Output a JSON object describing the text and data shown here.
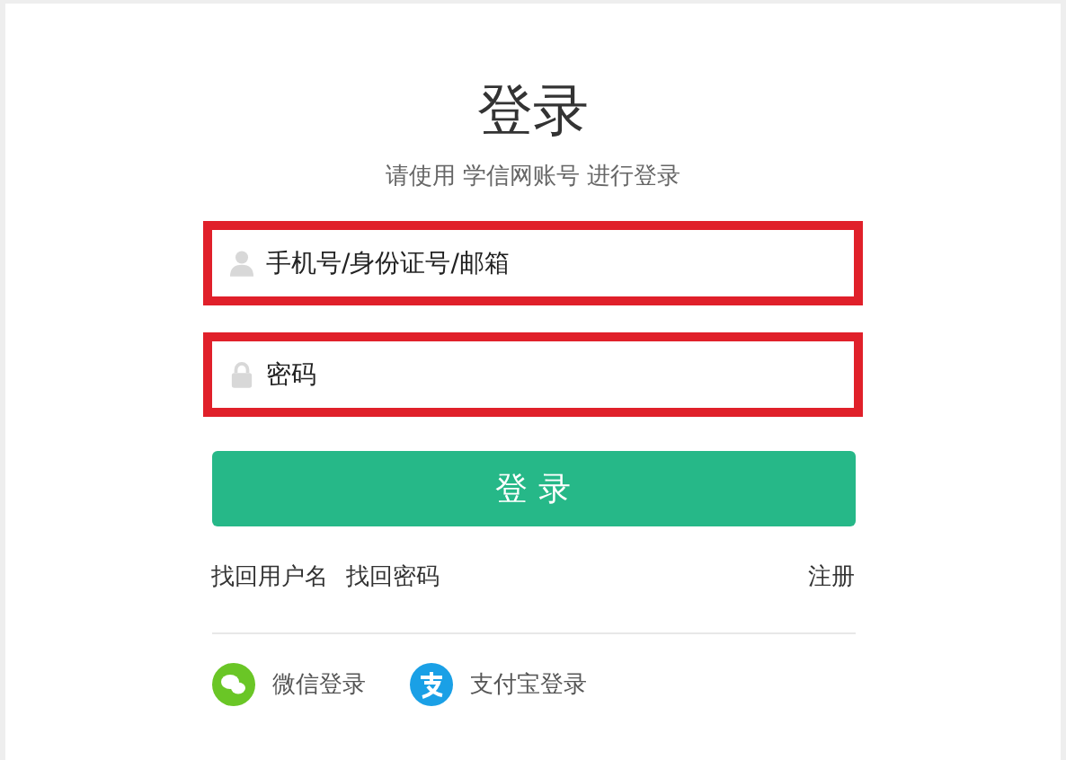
{
  "title": "登录",
  "subtitle": "请使用 学信网账号 进行登录",
  "fields": [
    {
      "kind": "user",
      "placeholder": "手机号/身份证号/邮箱",
      "highlighted": true
    },
    {
      "kind": "lock",
      "placeholder": "密码",
      "highlighted": true
    }
  ],
  "login_button": "登 录",
  "links_left": [
    "找回用户名",
    "找回密码"
  ],
  "link_right": "注册",
  "social": [
    {
      "kind": "wechat",
      "label": "微信登录",
      "color": "#6ac626"
    },
    {
      "kind": "alipay",
      "label": "支付宝登录",
      "color": "#1aa0e6"
    }
  ]
}
